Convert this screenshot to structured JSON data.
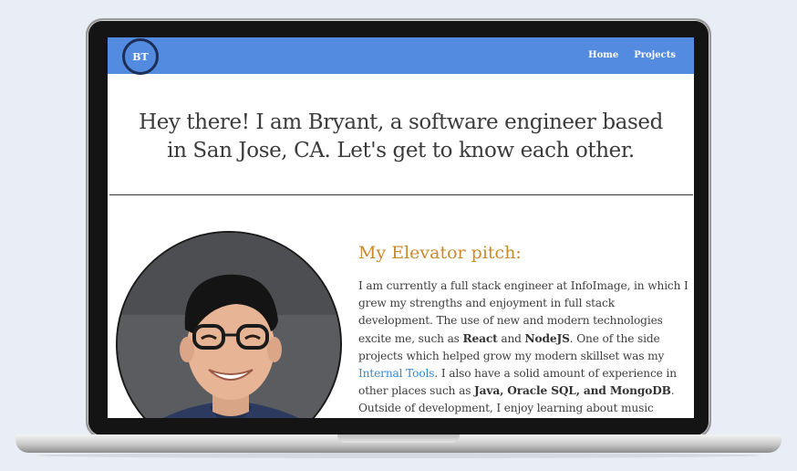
{
  "navbar": {
    "logo": "BT",
    "links": [
      "Home",
      "Projects"
    ]
  },
  "hero": {
    "line1": "Hey there! I am Bryant, a software engineer based",
    "line2": "in San Jose, CA. Let's get to know each other."
  },
  "pitch": {
    "title": "My Elevator pitch:",
    "t1": "I am currently a full stack engineer at InfoImage, in which I grew my strengths and enjoyment in full stack development. The use of new and modern technologies excite me, such as ",
    "b1": "React",
    "t2": " and ",
    "b2": "NodeJS",
    "t3": ". One of the side projects which helped grow my modern skillset was my ",
    "link": "Internal Tools",
    "t4": ". I also have a solid amount of experience in other places such as ",
    "b3": "Java, Oracle SQL, and MongoDB",
    "t5": ". Outside of development, I enjoy learning about music theory. I am currently open to"
  },
  "colors": {
    "navbar": "#528be0",
    "pitch_title": "#c78a2d",
    "link": "#2f8ad8"
  }
}
